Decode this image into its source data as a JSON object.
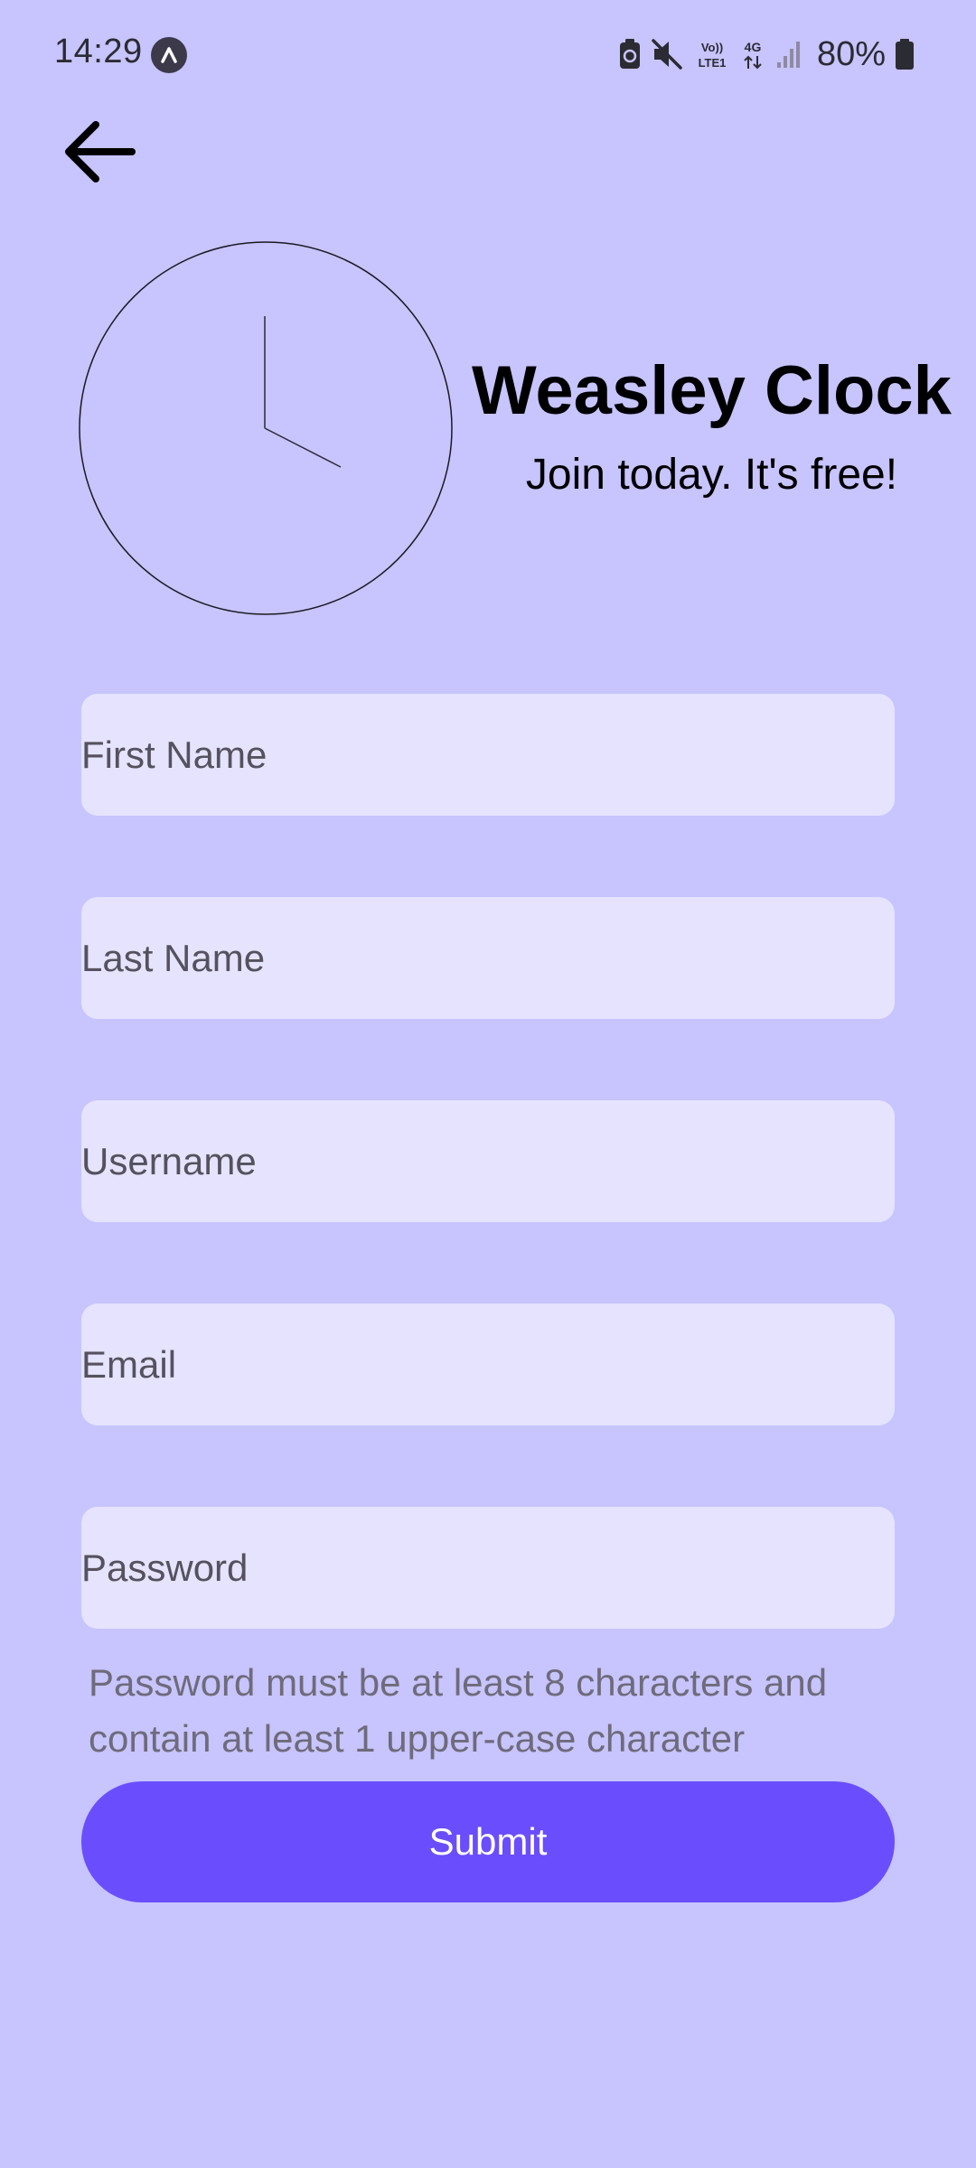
{
  "status_bar": {
    "time": "14:29",
    "battery": "80%",
    "icons": [
      "app-notification-icon",
      "battery-saver-icon",
      "mute-icon",
      "volte-icon",
      "4g-data-icon",
      "signal-icon",
      "battery-icon"
    ],
    "volte_label": "Vo)) LTE1",
    "network_label": "4G"
  },
  "header": {
    "back_icon": "arrow-left-icon",
    "logo_icon": "clock-icon",
    "title": "Weasley Clock",
    "subtitle": "Join today. It's free!"
  },
  "form": {
    "first_name": {
      "placeholder": "First Name",
      "value": ""
    },
    "last_name": {
      "placeholder": "Last Name",
      "value": ""
    },
    "username": {
      "placeholder": "Username",
      "value": ""
    },
    "email": {
      "placeholder": "Email",
      "value": ""
    },
    "password": {
      "placeholder": "Password",
      "value": ""
    },
    "password_hint": "Password must be at least 8 characters and contain at least 1 upper-case character",
    "submit_label": "Submit"
  },
  "colors": {
    "background": "#c7c4fe",
    "field_background": "#e5e3fe",
    "accent": "#6a4efd",
    "button_text": "#ffffff"
  }
}
